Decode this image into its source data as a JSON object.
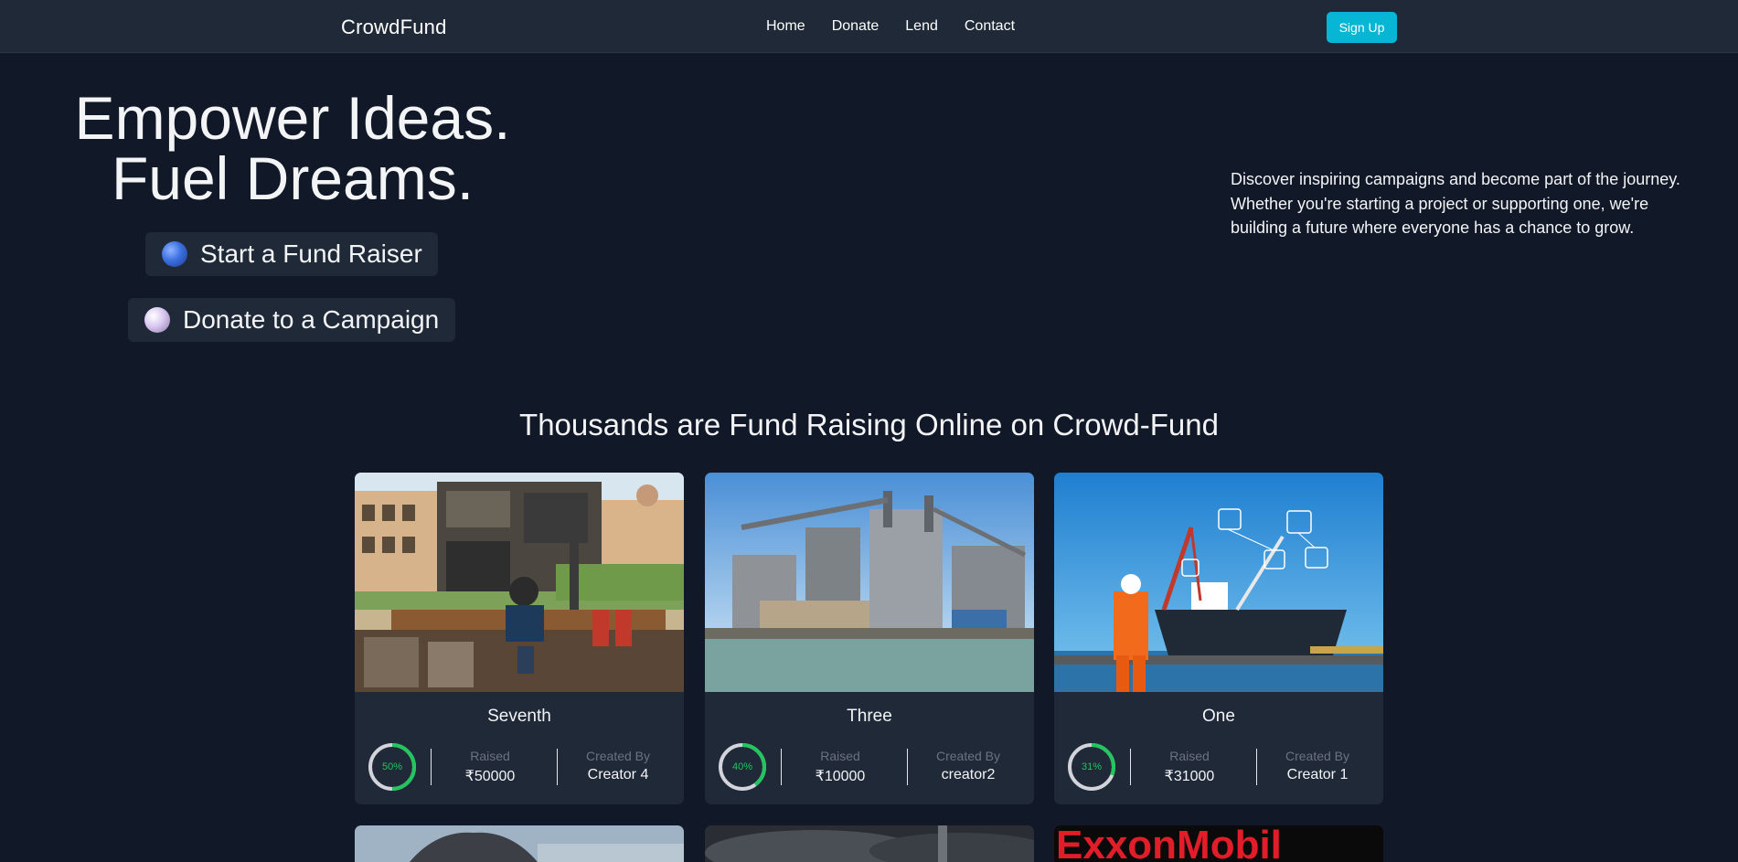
{
  "nav": {
    "brand": "CrowdFund",
    "links": [
      "Home",
      "Donate",
      "Lend",
      "Contact"
    ],
    "signup_label": "Sign Up"
  },
  "hero": {
    "title_line1": "Empower Ideas.",
    "title_line2": "Fuel Dreams.",
    "cta_start": "Start a Fund Raiser",
    "cta_donate": "Donate to a Campaign",
    "description": "Discover inspiring campaigns and become part of the journey. Whether you're starting a project or supporting one, we're building a future where everyone has a chance to grow."
  },
  "section": {
    "title": "Thousands are Fund Raising Online on Crowd-Fund"
  },
  "labels": {
    "raised": "Raised",
    "created_by": "Created By"
  },
  "campaigns": [
    {
      "name": "Seventh",
      "percent_label": "50%",
      "progress": 0.5,
      "raised": "₹50000",
      "creator": "Creator 4",
      "image": "engineering-workspace-illustration"
    },
    {
      "name": "Three",
      "percent_label": "40%",
      "progress": 0.4,
      "raised": "₹10000",
      "creator": "creator2",
      "image": "industrial-port-facility-photo"
    },
    {
      "name": "One",
      "percent_label": "31%",
      "progress": 0.31,
      "raised": "₹31000",
      "creator": "Creator 1",
      "image": "worker-and-cargo-ship-photo"
    }
  ],
  "partial_cards": [
    {
      "image": "dome-building-photo"
    },
    {
      "image": "smokestack-photo"
    },
    {
      "image": "exxonmobil-logo-image",
      "logo_text": "ExxonMobil"
    }
  ],
  "colors": {
    "background": "#111827",
    "navbar": "#1f2937",
    "card": "#1f2937",
    "accent": "#06b6d4",
    "progress": "#22c55e"
  }
}
